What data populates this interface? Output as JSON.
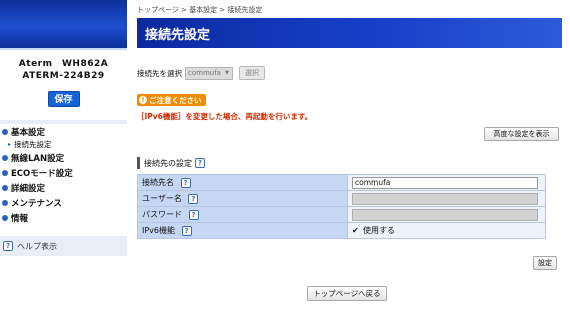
{
  "sidebar": {
    "model_line1": "Aterm　WH862A",
    "model_line2": "ATERM-224B29",
    "save_label": "保存",
    "nav": [
      {
        "label": "基本設定"
      },
      {
        "label": "無線LAN設定"
      },
      {
        "label": "ECOモード設定"
      },
      {
        "label": "詳細設定"
      },
      {
        "label": "メンテナンス"
      },
      {
        "label": "情報"
      }
    ],
    "sub_item": "接続先設定",
    "help_label": "ヘルプ表示"
  },
  "breadcrumb": "トップページ > 基本設定 > 接続先設定",
  "page_title": "接続先設定",
  "select_row": {
    "label": "接続先を選択",
    "value": "commufa",
    "button": "選択"
  },
  "notice": {
    "badge": "ご注意ください",
    "text": "［IPv6機能］を変更した場合、再起動を行います。"
  },
  "advanced_button": "高度な設定を表示",
  "section_title": "接続先の設定",
  "form": {
    "rows": [
      {
        "label": "接続先名",
        "value": "commufa"
      },
      {
        "label": "ユーザー名",
        "value": ""
      },
      {
        "label": "パスワード",
        "value": ""
      },
      {
        "label": "IPv6機能",
        "check_label": "使用する"
      }
    ]
  },
  "set_button": "設定",
  "back_button": "トップページへ戻る",
  "colors": {
    "title_bar": "#163fc8",
    "notice_badge": "#f08c00",
    "notice_text": "#d22b00",
    "table_label_bg": "#c5d7f3"
  }
}
